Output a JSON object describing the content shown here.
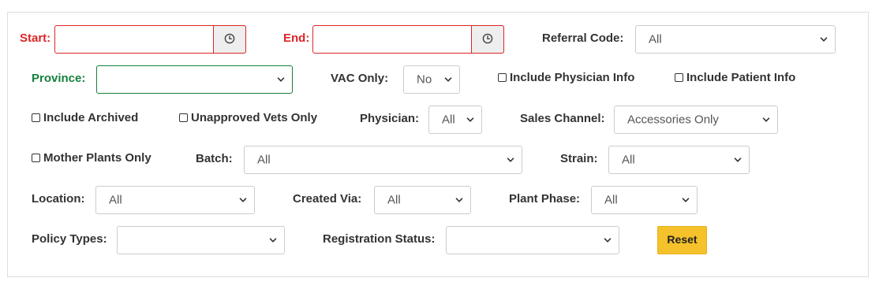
{
  "start": {
    "label": "Start:",
    "value": "",
    "icon": "clock-icon"
  },
  "end": {
    "label": "End:",
    "value": "",
    "icon": "clock-icon"
  },
  "referral_code": {
    "label": "Referral Code:",
    "value": "All"
  },
  "province": {
    "label": "Province:",
    "value": ""
  },
  "vac_only": {
    "label": "VAC Only:",
    "value": "No"
  },
  "include_physician_info": {
    "label": "Include Physician Info",
    "checked": false
  },
  "include_patient_info": {
    "label": "Include Patient Info",
    "checked": false
  },
  "include_archived": {
    "label": "Include Archived",
    "checked": false
  },
  "unapproved_vets_only": {
    "label": "Unapproved Vets Only",
    "checked": false
  },
  "physician": {
    "label": "Physician:",
    "value": "All"
  },
  "sales_channel": {
    "label": "Sales Channel:",
    "value": "Accessories Only"
  },
  "mother_plants_only": {
    "label": "Mother Plants Only",
    "checked": false
  },
  "batch": {
    "label": "Batch:",
    "value": "All"
  },
  "strain": {
    "label": "Strain:",
    "value": "All"
  },
  "location": {
    "label": "Location:",
    "value": "All"
  },
  "created_via": {
    "label": "Created Via:",
    "value": "All"
  },
  "plant_phase": {
    "label": "Plant Phase:",
    "value": "All"
  },
  "policy_types": {
    "label": "Policy Types:",
    "value": ""
  },
  "registration_status": {
    "label": "Registration Status:",
    "value": ""
  },
  "reset": {
    "label": "Reset"
  },
  "colors": {
    "required": "#dc2626",
    "valid": "#15803d",
    "button": "#f5c22b"
  }
}
